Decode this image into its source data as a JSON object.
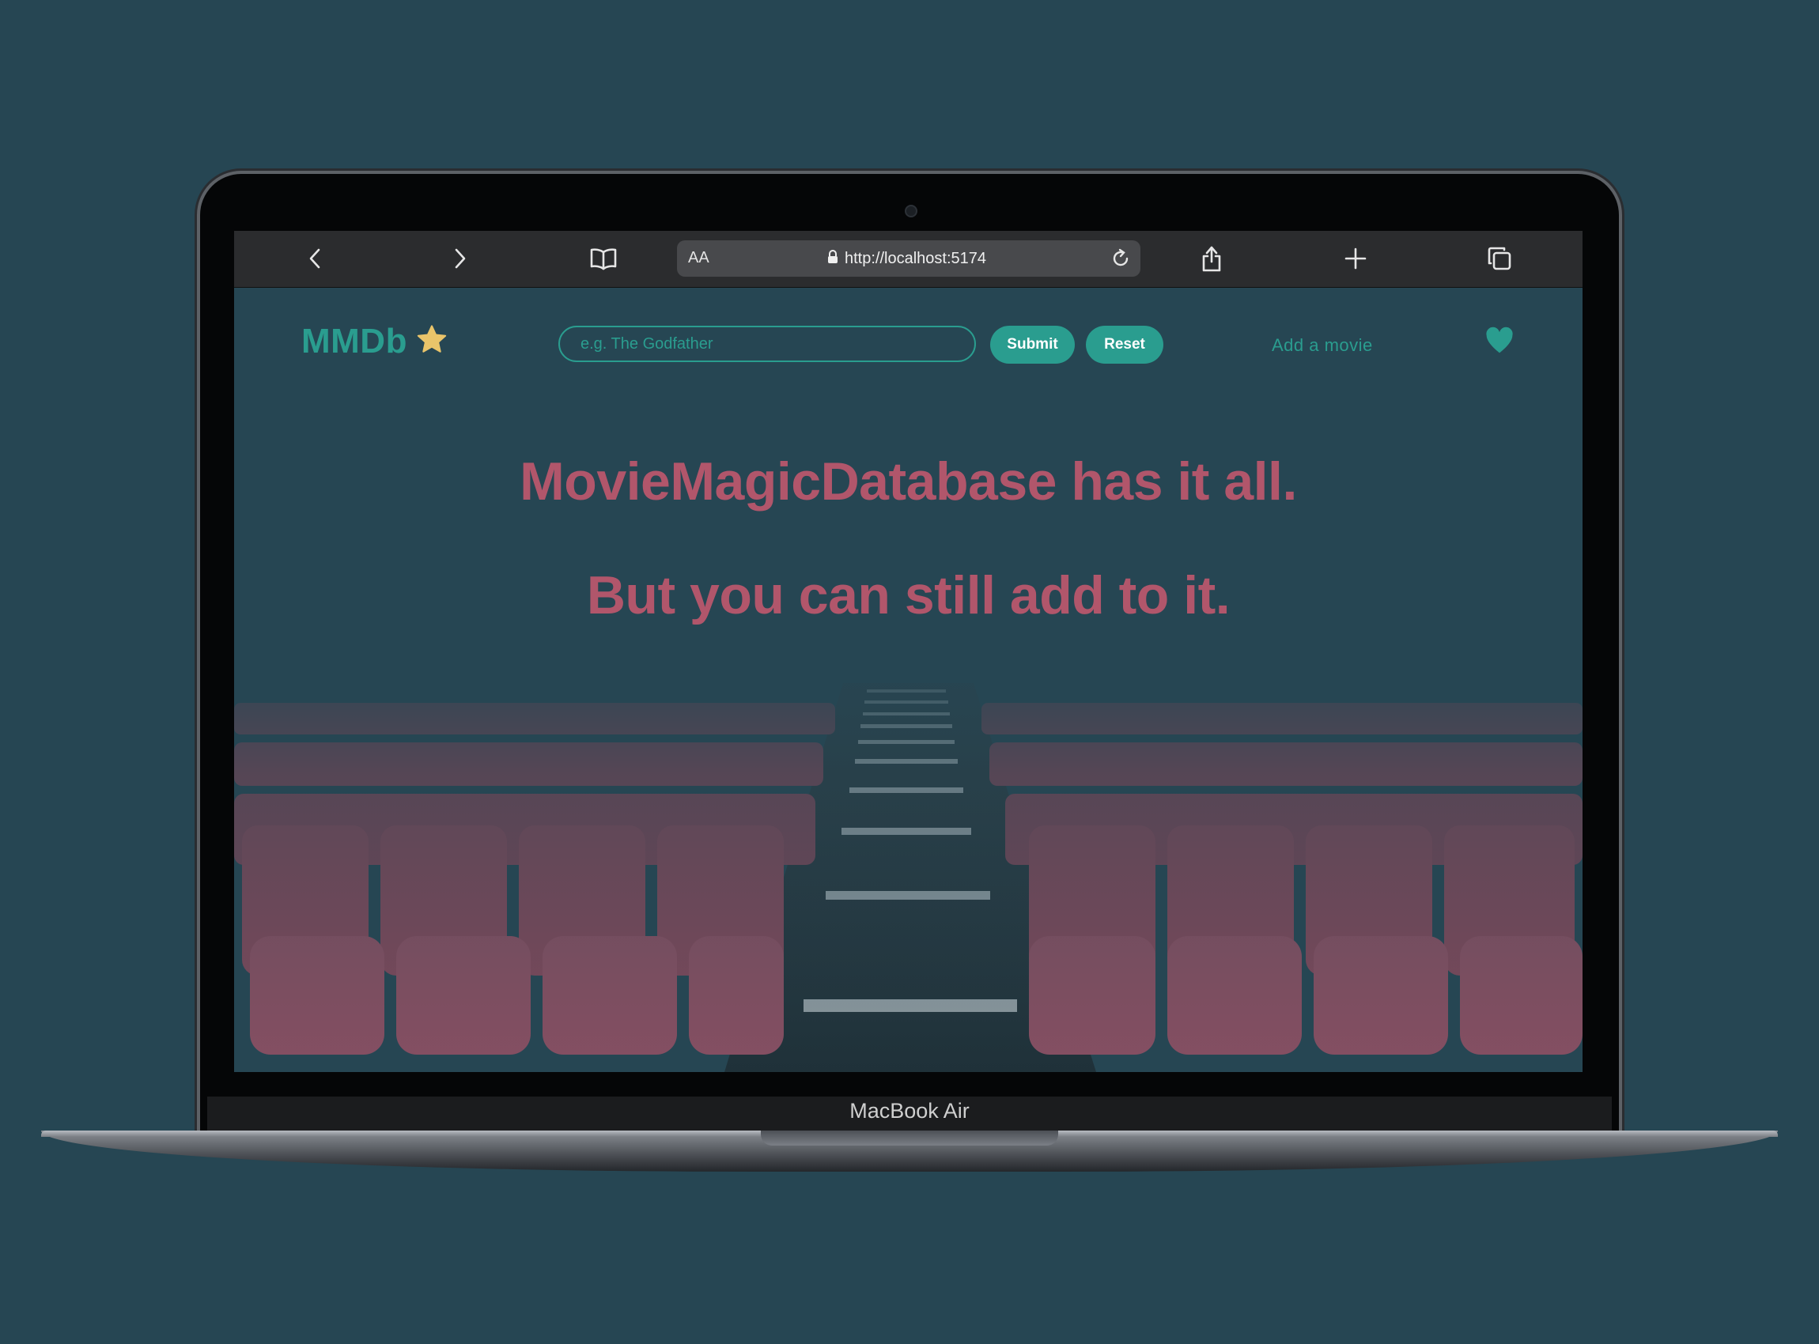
{
  "device": {
    "label": "MacBook Air"
  },
  "browser": {
    "reader_label": "AA",
    "url": "http://localhost:5174",
    "icons": [
      "back-icon",
      "forward-icon",
      "bookmarks-icon",
      "lock-icon",
      "reload-icon",
      "share-icon",
      "new-tab-icon",
      "tabs-icon"
    ]
  },
  "site": {
    "logo_text": "MMDb",
    "logo_icon": "star-icon",
    "search": {
      "placeholder": "e.g. The Godfather",
      "value": ""
    },
    "submit_label": "Submit",
    "reset_label": "Reset",
    "add_movie_label": "Add a movie",
    "favorites_icon": "heart-icon",
    "headline_1": "MovieMagicDatabase has it all.",
    "headline_2": "But you can still add to it."
  },
  "colors": {
    "background": "#264653",
    "accent": "#2a9d8f",
    "headline": "#b1566b",
    "star": "#e9c46a",
    "seat": "#9b4a5d"
  }
}
